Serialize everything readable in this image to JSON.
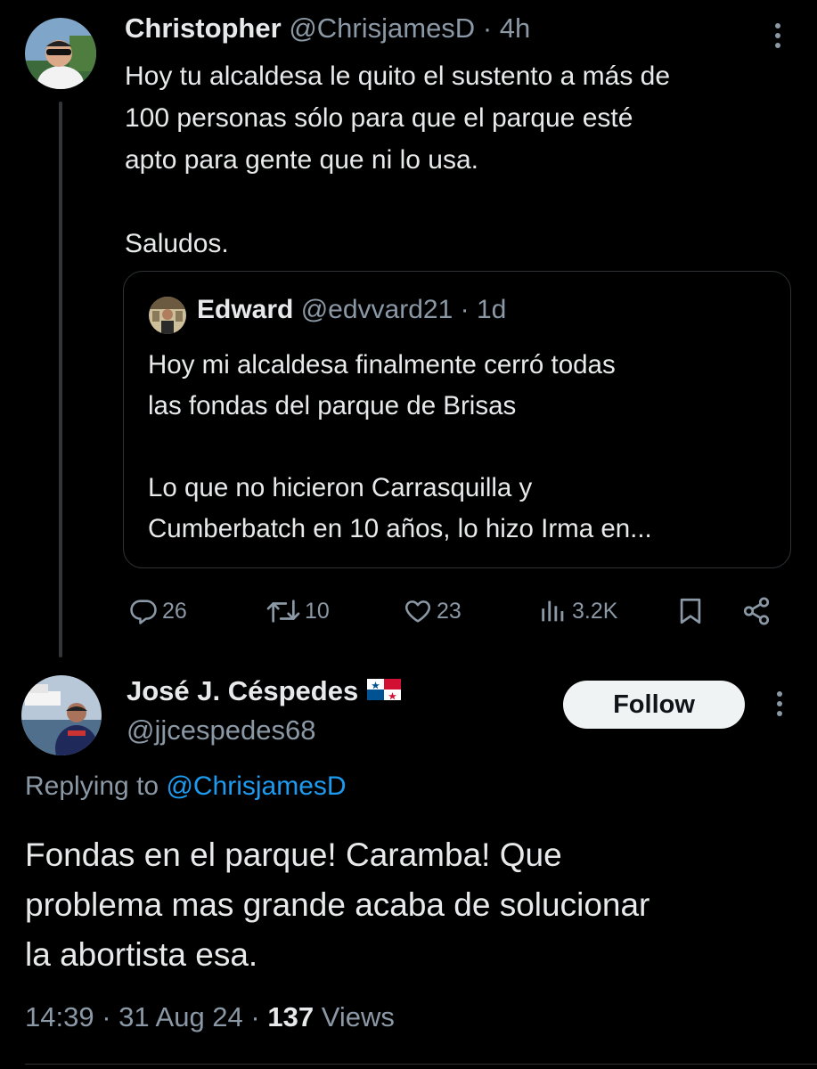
{
  "parent_tweet": {
    "author_name": "Christopher",
    "author_handle": "@ChrisjamesD",
    "separator": "·",
    "time": "4h",
    "text": "Hoy tu alcaldesa le quito el sustento a más de\n100 personas sólo para que el parque esté\napto para gente que ni lo usa.\n\nSaludos.",
    "quote": {
      "author_name": "Edward",
      "author_handle": "@edvvard21",
      "separator": "·",
      "time": "1d",
      "text": "Hoy mi alcaldesa finalmente cerró todas\nlas fondas del parque de Brisas\n\nLo que no hicieron Carrasquilla y\nCumberbatch en 10 años, lo hizo Irma en..."
    },
    "actions": {
      "replies": "26",
      "retweets": "10",
      "likes": "23",
      "views": "3.2K"
    }
  },
  "reply_tweet": {
    "author_name": "José J. Céspedes",
    "author_flag": "panama-flag",
    "author_handle": "@jjcespedes68",
    "follow_label": "Follow",
    "replying_prefix": "Replying to",
    "replying_to": "@ChrisjamesD",
    "text": "Fondas en el parque! Caramba! Que\nproblema mas grande acaba de solucionar\nla abortista esa.",
    "time": "14:39",
    "separator": "·",
    "date": "31 Aug 24",
    "views_count": "137",
    "views_label": "Views"
  },
  "colors": {
    "background": "#000000",
    "text": "#e7e9ea",
    "muted": "#8b98a5",
    "link": "#1d9bf0",
    "border": "#2f3336",
    "follow_bg": "#eff3f4"
  },
  "icons": [
    "more-vertical-icon",
    "reply-icon",
    "retweet-icon",
    "like-icon",
    "views-icon",
    "bookmark-icon",
    "share-icon"
  ]
}
